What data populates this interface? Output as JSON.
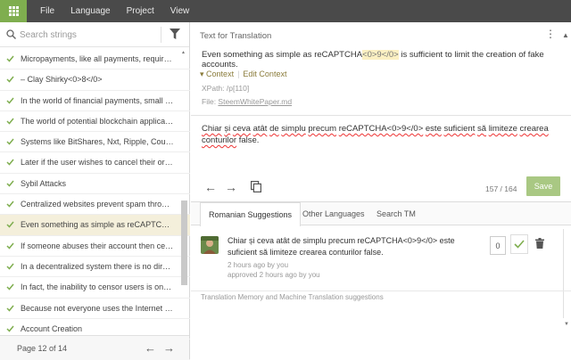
{
  "topbar": {
    "menu": [
      "File",
      "Language",
      "Project",
      "View"
    ]
  },
  "left": {
    "search_placeholder": "Search strings",
    "rows": [
      "Micropayments, like all payments, require a ...",
      "– Clay Shirky<0>8</0>",
      "In the world of financial payments, small fee...",
      "The world of potential blockchain applicatio...",
      "Systems like BitShares, Nxt, Ripple, Counter ...",
      "Later if the user wishes to cancel their order,...",
      "Sybil Attacks",
      "Centralized websites prevent spam through ...",
      "Even something as simple as reCAPTCHA<0>...",
      "If someone abuses their account then centra...",
      "In a decentralized system there is no direct ...",
      "In fact, the inability to censor users is one of ...",
      "Because not everyone uses the Internet at th...",
      "Account Creation",
      "Steem's account-based system with publicly ..."
    ],
    "selected_index": 8,
    "pager_label": "Page 12 of 14"
  },
  "editor": {
    "header_title": "Text for Translation",
    "source_pre": "Even something as simple as reCAPTCHA",
    "source_tag": "<0>9</0>",
    "source_post": " is sufficient to limit the creation of fake accounts.",
    "context_label": "Context",
    "edit_context_label": "Edit Context",
    "xpath": "XPath: /p[110]",
    "file_prefix": "File: ",
    "file_name": "SteemWhitePaper.md",
    "translation_words": [
      "Chiar",
      " ",
      "și",
      " ",
      "ceva",
      " ",
      "atât",
      " ",
      "de",
      " ",
      "simplu",
      " ",
      "precum",
      " ",
      "reCAPTCHA<0>9</0>",
      " ",
      "este",
      " ",
      "suficient",
      " ",
      "să",
      " ",
      "limiteze",
      " ",
      "crearea",
      " ",
      "conturilor",
      " false."
    ],
    "counter": "157 / 164",
    "save_label": "Save"
  },
  "tabs": [
    "Romanian Suggestions",
    "Other Languages",
    "Search TM"
  ],
  "suggestion": {
    "text": "Chiar și ceva atât de simplu precum reCAPTCHA<0>9</0> este suficient să limiteze crearea conturilor false.",
    "meta1": "2 hours ago by you",
    "meta2": "approved 2 hours ago by you",
    "votes": "0"
  },
  "tm_label": "Translation Memory and Machine Translation suggestions",
  "colors": {
    "accent": "#7fae4f",
    "save": "#a9c883",
    "topbar": "#4a4a4a"
  }
}
